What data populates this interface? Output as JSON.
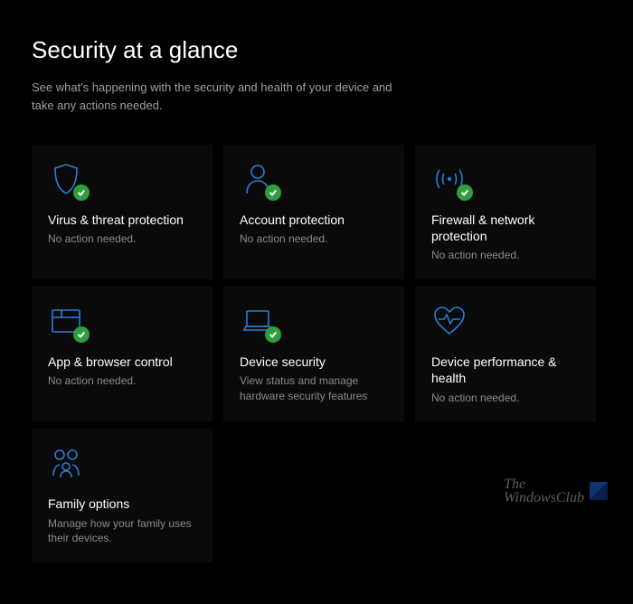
{
  "header": {
    "title": "Security at a glance",
    "subtitle": "See what's happening with the security and health of your device and take any actions needed."
  },
  "tiles": [
    {
      "icon": "shield-icon",
      "title": "Virus & threat protection",
      "status": "No action needed.",
      "badge": true
    },
    {
      "icon": "person-icon",
      "title": "Account protection",
      "status": "No action needed.",
      "badge": true
    },
    {
      "icon": "antenna-icon",
      "title": "Firewall & network protection",
      "status": "No action needed.",
      "badge": true
    },
    {
      "icon": "browser-icon",
      "title": "App & browser control",
      "status": "No action needed.",
      "badge": true
    },
    {
      "icon": "laptop-icon",
      "title": "Device security",
      "status": "View status and manage hardware security features",
      "badge": true
    },
    {
      "icon": "heart-icon",
      "title": "Device performance & health",
      "status": "No action needed.",
      "badge": false
    },
    {
      "icon": "family-icon",
      "title": "Family options",
      "status": "Manage how your family uses their devices.",
      "badge": false
    }
  ],
  "watermark": {
    "line1": "The",
    "line2": "WindowsClub"
  },
  "colors": {
    "icon_stroke": "#2a7cd6",
    "badge_bg": "#2e9e3e"
  }
}
